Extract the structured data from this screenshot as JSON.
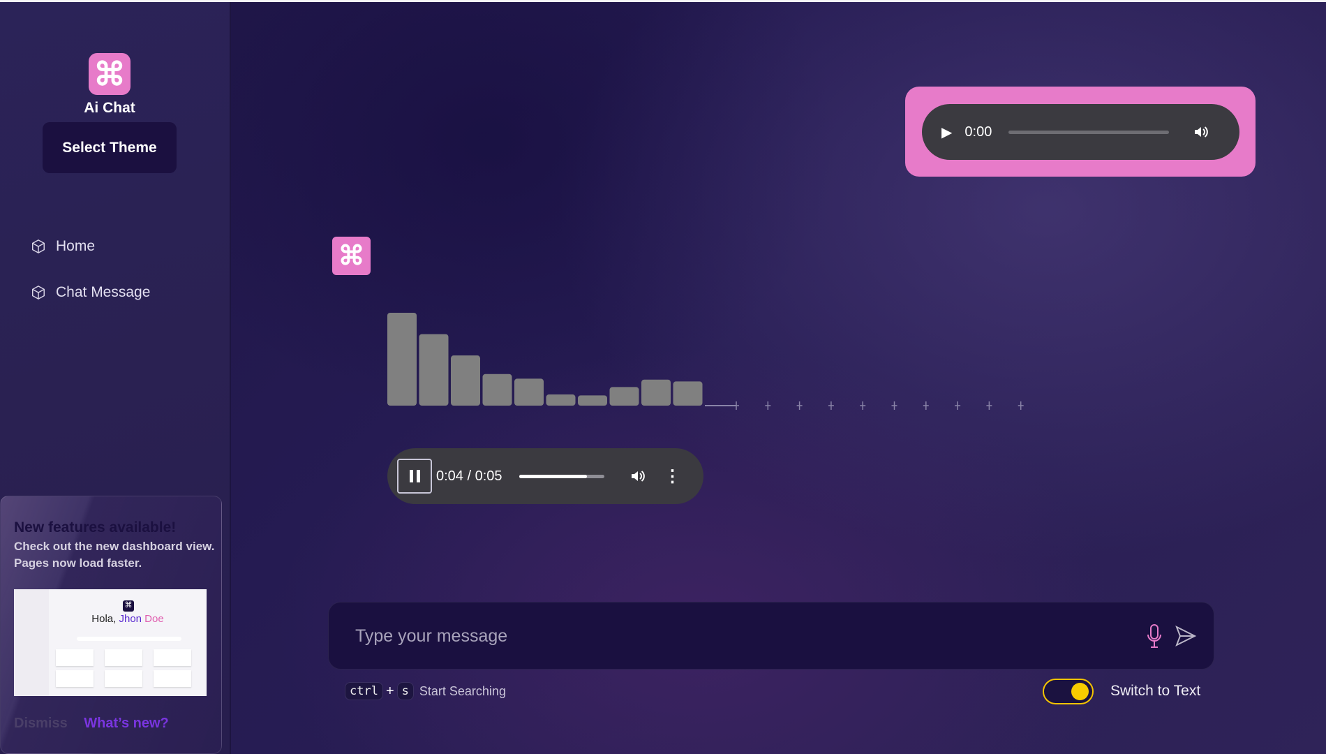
{
  "app": {
    "title": "Ai Chat",
    "logo_icon": "command-icon",
    "theme_button": "Select Theme",
    "accent": "#e77bc9"
  },
  "sidebar": {
    "items": [
      {
        "label": "Home",
        "icon": "cube-icon"
      },
      {
        "label": "Chat Message",
        "icon": "cube-icon"
      }
    ]
  },
  "announcement": {
    "title": "New features available!",
    "body": "Check out the new dashboard view. Pages now load faster.",
    "preview": {
      "greeting": "Hola, ",
      "name_first": "Jhon",
      "name_last": " Doe"
    },
    "dismiss": "Dismiss",
    "whats_new": "What’s new?"
  },
  "top_audio": {
    "time": "0:00",
    "progress": 0,
    "state": "paused"
  },
  "waveform": {
    "levels": [
      1.0,
      0.77,
      0.54,
      0.34,
      0.29,
      0.12,
      0.11,
      0.2,
      0.28,
      0.26
    ],
    "silent_markers": 10
  },
  "message_audio": {
    "time": "0:04 / 0:05",
    "progress": 0.8,
    "state": "playing"
  },
  "composer": {
    "placeholder": "Type your message",
    "mic_icon": "microphone-icon",
    "send_icon": "send-icon"
  },
  "shortcut": {
    "key1": "ctrl",
    "plus": "+",
    "key2": "s",
    "label": "Start Searching"
  },
  "toggle": {
    "label": "Switch to Text",
    "on": true,
    "color": "#f8cc00"
  }
}
